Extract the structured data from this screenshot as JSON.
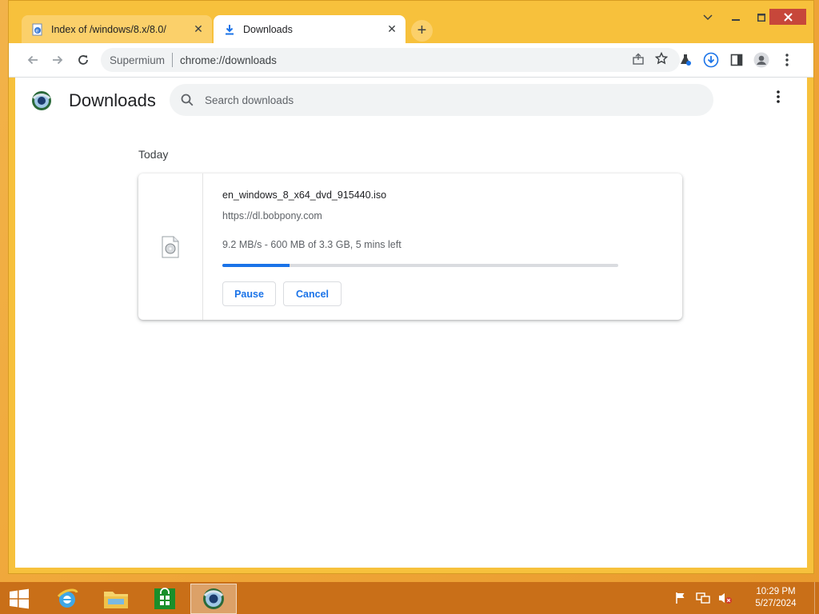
{
  "browser": {
    "tabs": [
      {
        "title": "Index of /windows/8.x/8.0/",
        "active": false
      },
      {
        "title": "Downloads",
        "active": true
      }
    ],
    "omnibox": {
      "label": "Supermium",
      "url": "chrome://downloads"
    }
  },
  "page": {
    "title": "Downloads",
    "search_placeholder": "Search downloads",
    "section": "Today",
    "download": {
      "file_name": "en_windows_8_x64_dvd_915440.iso",
      "source": "https://dl.bobpony.com",
      "status": "9.2 MB/s - 600 MB of 3.3 GB, 5 mins left",
      "progress": 0.17,
      "pause_label": "Pause",
      "cancel_label": "Cancel"
    }
  },
  "taskbar": {
    "apps": [
      "start-icon",
      "internet-explorer-icon",
      "file-explorer-icon",
      "store-icon",
      "supermium-icon"
    ],
    "clock": {
      "time": "10:29 PM",
      "date": "5/27/2024"
    }
  },
  "colors": {
    "accent": "#1a73e8",
    "frame": "#f7c13c",
    "taskbar": "#c96f18"
  }
}
